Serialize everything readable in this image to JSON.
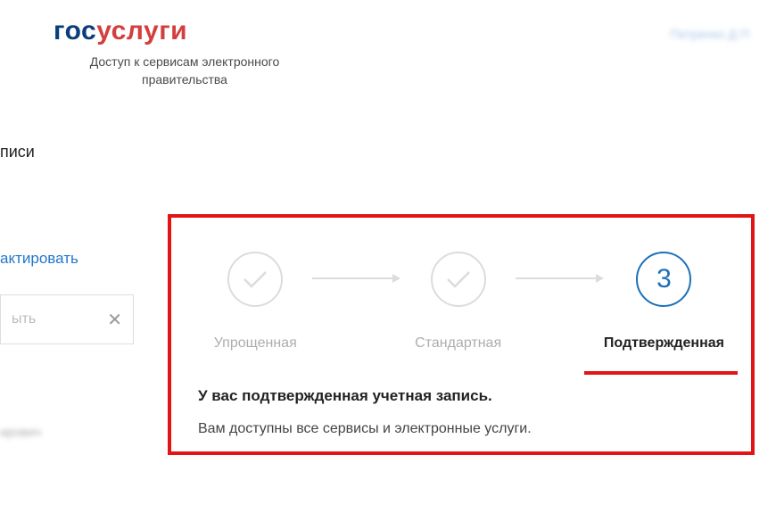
{
  "logo": {
    "part1": "гос",
    "part2": "услуги"
  },
  "tagline": "Доступ к сервисам электронного правительства",
  "user_name": "Петренко Д П",
  "section_label": "писи",
  "sidebar": {
    "edit_label": "актировать",
    "input_placeholder": "ыть",
    "blurred_name": "ирович"
  },
  "steps": {
    "step1": {
      "label": "Упрощенная"
    },
    "step2": {
      "label": "Стандартная"
    },
    "step3": {
      "label": "Подтвержденная",
      "number": "3"
    }
  },
  "card": {
    "title": "У вас подтвержденная учетная запись.",
    "subtitle": "Вам доступны все сервисы и электронные услуги."
  }
}
